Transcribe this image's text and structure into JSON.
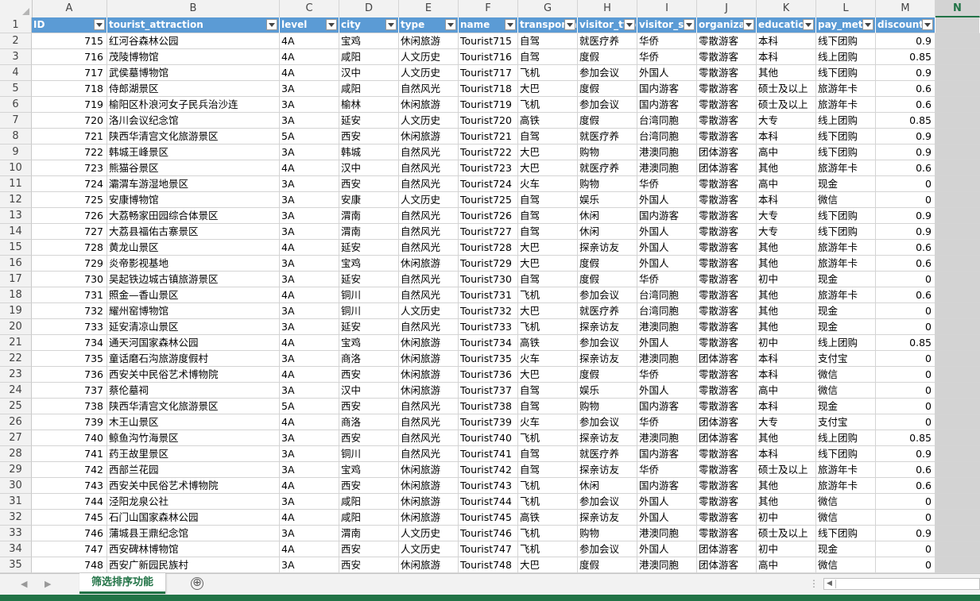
{
  "columns": [
    "A",
    "B",
    "C",
    "D",
    "E",
    "F",
    "G",
    "H",
    "I",
    "J",
    "K",
    "L",
    "M",
    "N"
  ],
  "selected_column": "N",
  "header_row_number": "1",
  "headers": [
    "ID",
    "tourist_attraction",
    "level",
    "city",
    "type",
    "name",
    "transporta",
    "visitor_typ",
    "visitor_sta",
    "organizati",
    "education",
    "pay_meth",
    "discount"
  ],
  "rows": [
    {
      "num": "2",
      "cells": [
        "715",
        "红河谷森林公园",
        "4A",
        "宝鸡",
        "休闲旅游",
        "Tourist715",
        "自驾",
        "就医疗养",
        "华侨",
        "零散游客",
        "本科",
        "线下团购",
        "0.9"
      ]
    },
    {
      "num": "3",
      "cells": [
        "716",
        "茂陵博物馆",
        "4A",
        "咸阳",
        "人文历史",
        "Tourist716",
        "自驾",
        "度假",
        "华侨",
        "零散游客",
        "本科",
        "线上团购",
        "0.85"
      ]
    },
    {
      "num": "4",
      "cells": [
        "717",
        "武侯墓博物馆",
        "4A",
        "汉中",
        "人文历史",
        "Tourist717",
        "飞机",
        "参加会议",
        "外国人",
        "零散游客",
        "其他",
        "线下团购",
        "0.9"
      ]
    },
    {
      "num": "5",
      "cells": [
        "718",
        "侍郎湖景区",
        "3A",
        "咸阳",
        "自然风光",
        "Tourist718",
        "大巴",
        "度假",
        "国内游客",
        "零散游客",
        "硕士及以上",
        "旅游年卡",
        "0.6"
      ]
    },
    {
      "num": "6",
      "cells": [
        "719",
        "榆阳区朴浪河女子民兵治沙连",
        "3A",
        "榆林",
        "休闲旅游",
        "Tourist719",
        "飞机",
        "参加会议",
        "国内游客",
        "零散游客",
        "硕士及以上",
        "旅游年卡",
        "0.6"
      ]
    },
    {
      "num": "7",
      "cells": [
        "720",
        "洛川会议纪念馆",
        "3A",
        "延安",
        "人文历史",
        "Tourist720",
        "高铁",
        "度假",
        "台湾同胞",
        "零散游客",
        "大专",
        "线上团购",
        "0.85"
      ]
    },
    {
      "num": "8",
      "cells": [
        "721",
        "陕西华清宫文化旅游景区",
        "5A",
        "西安",
        "休闲旅游",
        "Tourist721",
        "自驾",
        "就医疗养",
        "台湾同胞",
        "零散游客",
        "本科",
        "线下团购",
        "0.9"
      ]
    },
    {
      "num": "9",
      "cells": [
        "722",
        "韩城王峰景区",
        "3A",
        "韩城",
        "自然风光",
        "Tourist722",
        "大巴",
        "购物",
        "港澳同胞",
        "团体游客",
        "高中",
        "线下团购",
        "0.9"
      ]
    },
    {
      "num": "10",
      "cells": [
        "723",
        "熊猫谷景区",
        "4A",
        "汉中",
        "自然风光",
        "Tourist723",
        "大巴",
        "就医疗养",
        "港澳同胞",
        "团体游客",
        "其他",
        "旅游年卡",
        "0.6"
      ]
    },
    {
      "num": "11",
      "cells": [
        "724",
        "灞渭车游湿地景区",
        "3A",
        "西安",
        "自然风光",
        "Tourist724",
        "火车",
        "购物",
        "华侨",
        "零散游客",
        "高中",
        "现金",
        "0"
      ]
    },
    {
      "num": "12",
      "cells": [
        "725",
        "安康博物馆",
        "3A",
        "安康",
        "人文历史",
        "Tourist725",
        "自驾",
        "娱乐",
        "外国人",
        "零散游客",
        "本科",
        "微信",
        "0"
      ]
    },
    {
      "num": "13",
      "cells": [
        "726",
        "大荔畅家田园综合体景区",
        "3A",
        "渭南",
        "自然风光",
        "Tourist726",
        "自驾",
        "休闲",
        "国内游客",
        "零散游客",
        "大专",
        "线下团购",
        "0.9"
      ]
    },
    {
      "num": "14",
      "cells": [
        "727",
        "大荔县福佑古寨景区",
        "3A",
        "渭南",
        "自然风光",
        "Tourist727",
        "自驾",
        "休闲",
        "外国人",
        "零散游客",
        "大专",
        "线下团购",
        "0.9"
      ]
    },
    {
      "num": "15",
      "cells": [
        "728",
        "黄龙山景区",
        "4A",
        "延安",
        "自然风光",
        "Tourist728",
        "大巴",
        "探亲访友",
        "外国人",
        "零散游客",
        "其他",
        "旅游年卡",
        "0.6"
      ]
    },
    {
      "num": "16",
      "cells": [
        "729",
        "炎帝影视基地",
        "3A",
        "宝鸡",
        "休闲旅游",
        "Tourist729",
        "大巴",
        "度假",
        "外国人",
        "零散游客",
        "其他",
        "旅游年卡",
        "0.6"
      ]
    },
    {
      "num": "17",
      "cells": [
        "730",
        "吴起铁边城古镇旅游景区",
        "3A",
        "延安",
        "自然风光",
        "Tourist730",
        "自驾",
        "度假",
        "华侨",
        "零散游客",
        "初中",
        "现金",
        "0"
      ]
    },
    {
      "num": "18",
      "cells": [
        "731",
        "照金—香山景区",
        "4A",
        "铜川",
        "自然风光",
        "Tourist731",
        "飞机",
        "参加会议",
        "台湾同胞",
        "零散游客",
        "其他",
        "旅游年卡",
        "0.6"
      ]
    },
    {
      "num": "19",
      "cells": [
        "732",
        "耀州窑博物馆",
        "3A",
        "铜川",
        "人文历史",
        "Tourist732",
        "大巴",
        "就医疗养",
        "台湾同胞",
        "零散游客",
        "其他",
        "现金",
        "0"
      ]
    },
    {
      "num": "20",
      "cells": [
        "733",
        "延安清凉山景区",
        "3A",
        "延安",
        "自然风光",
        "Tourist733",
        "飞机",
        "探亲访友",
        "港澳同胞",
        "零散游客",
        "其他",
        "现金",
        "0"
      ]
    },
    {
      "num": "21",
      "cells": [
        "734",
        "通天河国家森林公园",
        "4A",
        "宝鸡",
        "休闲旅游",
        "Tourist734",
        "高铁",
        "参加会议",
        "外国人",
        "零散游客",
        "初中",
        "线上团购",
        "0.85"
      ]
    },
    {
      "num": "22",
      "cells": [
        "735",
        "童话磨石沟旅游度假村",
        "3A",
        "商洛",
        "休闲旅游",
        "Tourist735",
        "火车",
        "探亲访友",
        "港澳同胞",
        "团体游客",
        "本科",
        "支付宝",
        "0"
      ]
    },
    {
      "num": "23",
      "cells": [
        "736",
        "西安关中民俗艺术博物院",
        "4A",
        "西安",
        "休闲旅游",
        "Tourist736",
        "大巴",
        "度假",
        "华侨",
        "零散游客",
        "本科",
        "微信",
        "0"
      ]
    },
    {
      "num": "24",
      "cells": [
        "737",
        "蔡伦墓祠",
        "3A",
        "汉中",
        "休闲旅游",
        "Tourist737",
        "自驾",
        "娱乐",
        "外国人",
        "零散游客",
        "高中",
        "微信",
        "0"
      ]
    },
    {
      "num": "25",
      "cells": [
        "738",
        "陕西华清宫文化旅游景区",
        "5A",
        "西安",
        "自然风光",
        "Tourist738",
        "自驾",
        "购物",
        "国内游客",
        "零散游客",
        "本科",
        "现金",
        "0"
      ]
    },
    {
      "num": "26",
      "cells": [
        "739",
        "木王山景区",
        "4A",
        "商洛",
        "自然风光",
        "Tourist739",
        "火车",
        "参加会议",
        "华侨",
        "团体游客",
        "大专",
        "支付宝",
        "0"
      ]
    },
    {
      "num": "27",
      "cells": [
        "740",
        "鲸鱼沟竹海景区",
        "3A",
        "西安",
        "自然风光",
        "Tourist740",
        "飞机",
        "探亲访友",
        "港澳同胞",
        "团体游客",
        "其他",
        "线上团购",
        "0.85"
      ]
    },
    {
      "num": "28",
      "cells": [
        "741",
        "药王故里景区",
        "3A",
        "铜川",
        "自然风光",
        "Tourist741",
        "自驾",
        "就医疗养",
        "国内游客",
        "零散游客",
        "本科",
        "线下团购",
        "0.9"
      ]
    },
    {
      "num": "29",
      "cells": [
        "742",
        "西部兰花园",
        "3A",
        "宝鸡",
        "休闲旅游",
        "Tourist742",
        "自驾",
        "探亲访友",
        "华侨",
        "零散游客",
        "硕士及以上",
        "旅游年卡",
        "0.6"
      ]
    },
    {
      "num": "30",
      "cells": [
        "743",
        "西安关中民俗艺术博物院",
        "4A",
        "西安",
        "休闲旅游",
        "Tourist743",
        "飞机",
        "休闲",
        "国内游客",
        "零散游客",
        "其他",
        "旅游年卡",
        "0.6"
      ]
    },
    {
      "num": "31",
      "cells": [
        "744",
        "泾阳龙泉公社",
        "3A",
        "咸阳",
        "休闲旅游",
        "Tourist744",
        "飞机",
        "参加会议",
        "外国人",
        "零散游客",
        "其他",
        "微信",
        "0"
      ]
    },
    {
      "num": "32",
      "cells": [
        "745",
        "石门山国家森林公园",
        "4A",
        "咸阳",
        "休闲旅游",
        "Tourist745",
        "高铁",
        "探亲访友",
        "外国人",
        "零散游客",
        "初中",
        "微信",
        "0"
      ]
    },
    {
      "num": "33",
      "cells": [
        "746",
        "蒲城县王鼎纪念馆",
        "3A",
        "渭南",
        "人文历史",
        "Tourist746",
        "飞机",
        "购物",
        "港澳同胞",
        "零散游客",
        "硕士及以上",
        "线下团购",
        "0.9"
      ]
    },
    {
      "num": "34",
      "cells": [
        "747",
        "西安碑林博物馆",
        "4A",
        "西安",
        "人文历史",
        "Tourist747",
        "飞机",
        "参加会议",
        "外国人",
        "团体游客",
        "初中",
        "现金",
        "0"
      ]
    },
    {
      "num": "35",
      "cells": [
        "748",
        "西安广新园民族村",
        "3A",
        "西安",
        "休闲旅游",
        "Tourist748",
        "大巴",
        "度假",
        "港澳同胞",
        "团体游客",
        "高中",
        "微信",
        "0"
      ]
    }
  ],
  "sheet_tab": "筛选排序功能",
  "add_sheet_icon": "⊕",
  "colors": {
    "header_fill": "#5b9bd5",
    "accent": "#217346",
    "selected_column": "#d3d3d3"
  }
}
